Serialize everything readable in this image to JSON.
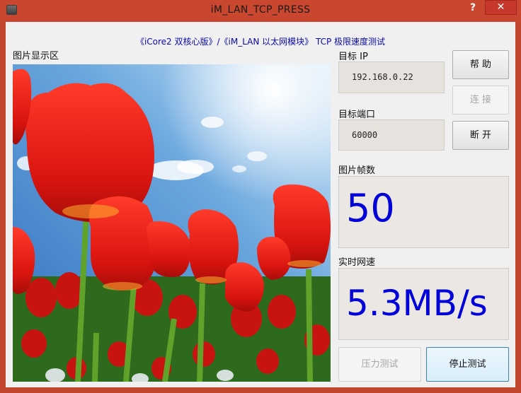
{
  "window": {
    "title": "iM_LAN_TCP_PRESS",
    "help_glyph": "?",
    "close_glyph": "✕"
  },
  "subtitle": "《iCore2 双核心版》/《iM_LAN 以太网模块》 TCP 极限速度测试",
  "image_panel": {
    "label": "图片显示区",
    "image_description": "red tulips under blue sky"
  },
  "target_ip": {
    "label": "目标  IP",
    "value": "192.168.0.22"
  },
  "target_port": {
    "label": "目标端口",
    "value": "60000"
  },
  "frame_count": {
    "label": "图片帧数",
    "value": "50"
  },
  "speed": {
    "label": "实时网速",
    "value": "5.3MB/s"
  },
  "buttons": {
    "help": "帮 助",
    "connect": "连 接",
    "disconnect": "断 开",
    "stress_test": "压力测试",
    "stop_test": "停止测试"
  },
  "colors": {
    "title_bar": "#c9472f",
    "close_button": "#c7372b",
    "subtitle_text": "#0a0aa8",
    "big_value_text": "#0000d8"
  }
}
